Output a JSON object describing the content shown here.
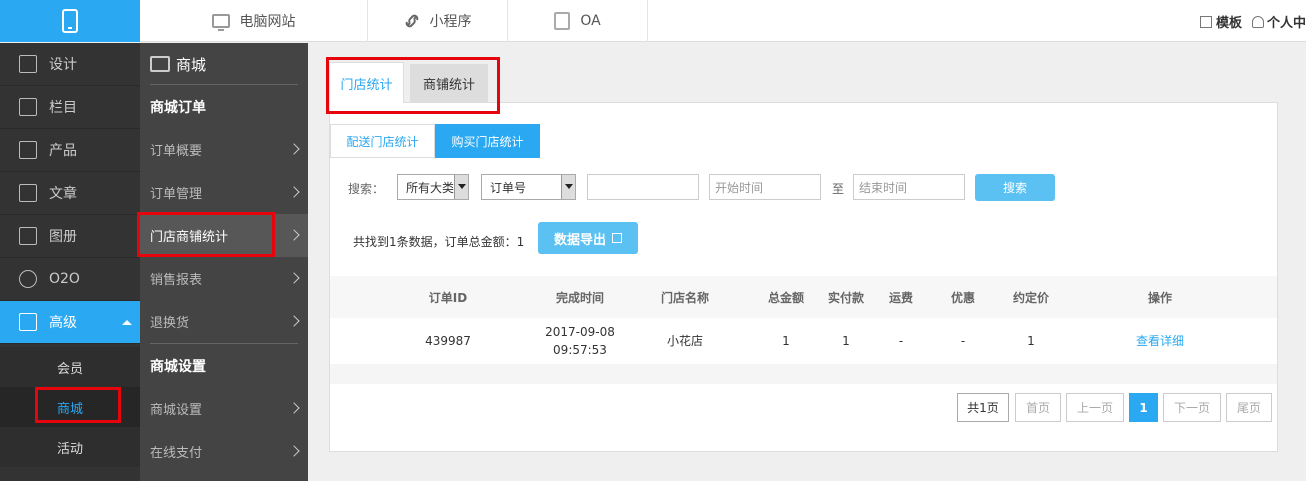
{
  "topbar": {
    "tabs": [
      {
        "label": "电脑网站",
        "icon": "monitor-icon"
      },
      {
        "label": "小程序",
        "icon": "link-icon"
      },
      {
        "label": "OA",
        "icon": "calendar-icon"
      }
    ],
    "template_label": "模板",
    "user_label": "个人中",
    "accent": "#2aa8f2"
  },
  "sidebar": {
    "items": [
      {
        "label": "设计",
        "icon": "design-icon"
      },
      {
        "label": "栏目",
        "icon": "list-icon"
      },
      {
        "label": "产品",
        "icon": "cube-icon"
      },
      {
        "label": "文章",
        "icon": "article-icon"
      },
      {
        "label": "图册",
        "icon": "image-icon"
      },
      {
        "label": "O2O",
        "icon": "o2o-icon"
      },
      {
        "label": "高级",
        "icon": "grid-icon"
      }
    ],
    "sub_items": [
      {
        "label": "会员"
      },
      {
        "label": "商城"
      },
      {
        "label": "活动"
      }
    ]
  },
  "subnav": {
    "title": "商城",
    "section1": "商城订单",
    "items1": [
      {
        "label": "订单概要"
      },
      {
        "label": "订单管理"
      },
      {
        "label": "门店商铺统计"
      },
      {
        "label": "销售报表"
      },
      {
        "label": "退换货"
      }
    ],
    "section2": "商城设置",
    "items2": [
      {
        "label": "商城设置"
      },
      {
        "label": "在线支付"
      }
    ]
  },
  "main": {
    "tabs": [
      {
        "label": "门店统计"
      },
      {
        "label": "商铺统计"
      }
    ],
    "subtabs": [
      {
        "label": "配送门店统计"
      },
      {
        "label": "购买门店统计"
      }
    ],
    "search": {
      "label": "搜索：",
      "category_value": "所有大类",
      "field_value": "订单号",
      "keyword_value": "",
      "start_placeholder": "开始时间",
      "to_label": "至",
      "end_placeholder": "结束时间",
      "button_label": "搜索"
    },
    "summary": "共找到1条数据，订单总金额：1",
    "export_label": "数据导出",
    "table": {
      "headers": [
        "订单ID",
        "完成时间",
        "门店名称",
        "总金额",
        "实付款",
        "运费",
        "优惠",
        "约定价",
        "操作"
      ],
      "rows": [
        {
          "order_id": "439987",
          "date": "2017-09-08",
          "time": "09:57:53",
          "store": "小花店",
          "total": "1",
          "paid": "1",
          "shipping": "-",
          "discount": "-",
          "agreed": "1",
          "action": "查看详细"
        }
      ]
    },
    "pagination": {
      "info": "共1页",
      "first": "首页",
      "prev": "上一页",
      "current": "1",
      "next": "下一页",
      "last": "尾页"
    }
  }
}
